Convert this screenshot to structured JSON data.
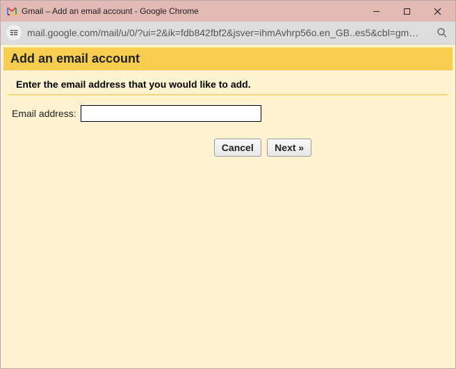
{
  "window": {
    "title": "Gmail – Add an email account - Google Chrome"
  },
  "address": {
    "url": "mail.google.com/mail/u/0/?ui=2&ik=fdb842fbf2&jsver=ihmAvhrp56o.en_GB..es5&cbl=gm…"
  },
  "page": {
    "heading": "Add an email account",
    "prompt": "Enter the email address that you would like to add.",
    "form": {
      "label": "Email address:",
      "value": ""
    },
    "buttons": {
      "cancel": "Cancel",
      "next": "Next »"
    }
  }
}
